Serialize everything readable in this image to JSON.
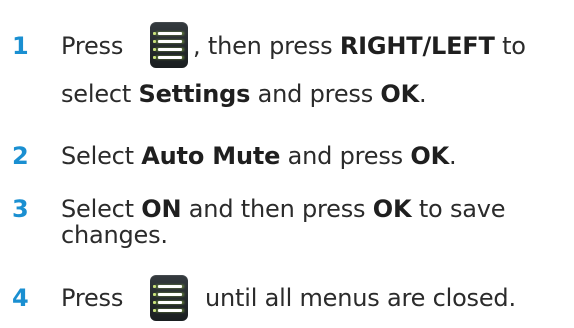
{
  "steps": [
    {
      "number": "1",
      "line1": {
        "t1": "Press",
        "t2": ", then press ",
        "b1": "RIGHT/LEFT",
        "t3": " to"
      },
      "line2": {
        "t1": "select ",
        "b1": "Settings",
        "t2": " and press ",
        "b2": "OK",
        "t3": "."
      }
    },
    {
      "number": "2",
      "line1": {
        "t1": "Select ",
        "b1": "Auto Mute",
        "t2": " and press ",
        "b2": "OK",
        "t3": "."
      }
    },
    {
      "number": "3",
      "line1": {
        "t1": "Select ",
        "b1": "ON",
        "t2": " and then press ",
        "b2": "OK",
        "t3": " to save"
      },
      "line2": {
        "t1": "changes."
      }
    },
    {
      "number": "4",
      "line1": {
        "t1": "Press",
        "t2": "until all menus are closed."
      }
    }
  ],
  "icons": {
    "menu_button": "menu-button-icon"
  },
  "colors": {
    "step_number": "#1a8fd1",
    "text": "#2b2b2b",
    "icon_bg": "#24292c",
    "icon_accent": "#9fd24a"
  }
}
